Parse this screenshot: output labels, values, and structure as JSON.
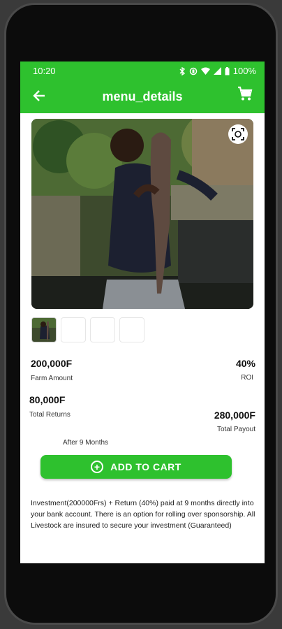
{
  "status_bar": {
    "time": "10:20",
    "battery": "100%"
  },
  "app_bar": {
    "title": "menu_details",
    "back_icon": "arrow-back-icon",
    "cart_icon": "shopping-cart-icon"
  },
  "colors": {
    "brand_green": "#2ec12e"
  },
  "product": {
    "image_alt": "Woman holding a large catfish at a fish pond",
    "thumbnail_count": 4
  },
  "stats": {
    "farm_amount": {
      "value": "200,000F",
      "label": "Farm Amount"
    },
    "roi": {
      "value": "40%",
      "label": "ROI"
    },
    "total_returns": {
      "value": "80,000F",
      "label": "Total Returns"
    },
    "total_payout": {
      "value": "280,000F",
      "label": "Total Payout"
    },
    "after_note": "After 9 Months"
  },
  "cta": {
    "label": "ADD TO CART"
  },
  "description": "Investment(200000Frs) + Return (40%) paid at 9 months directly into your bank account. There is an option for rolling over sponsorship. All Livestock are insured to secure your investment (Guaranteed)"
}
